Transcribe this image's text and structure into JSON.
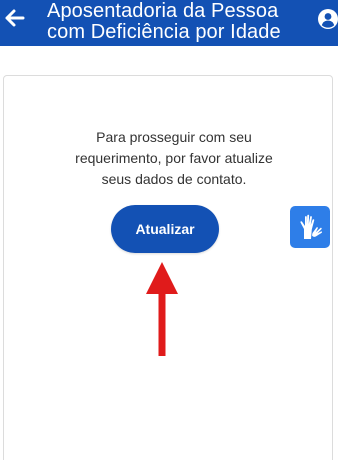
{
  "header": {
    "title": "Aposentadoria da Pessoa com Deficiência por Idade",
    "back_icon": "arrow-left-icon",
    "profile_icon": "user-circle-icon",
    "background_color": "#1351b4"
  },
  "main": {
    "message": "Para prosseguir com seu requerimento, por favor atualize seus dados de contato.",
    "update_button_label": "Atualizar"
  },
  "accessibility": {
    "vlibras_icon": "sign-language-hands-icon",
    "button_color": "#2e7ee8"
  },
  "annotation": {
    "arrow_icon": "red-arrow-up-icon",
    "arrow_color": "#e01b1b"
  }
}
